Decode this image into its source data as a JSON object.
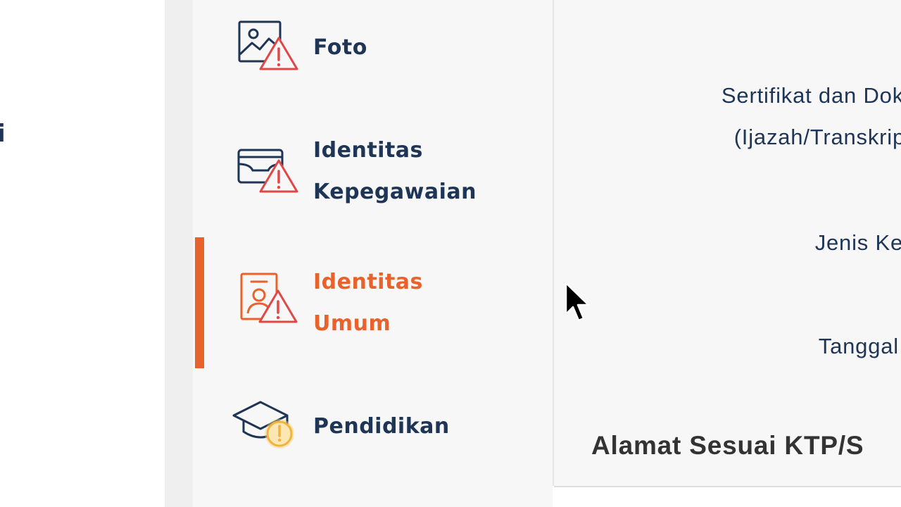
{
  "left_panel": {
    "edge_text": "i"
  },
  "sidebar": {
    "items": [
      {
        "label_lines": [
          "Foto"
        ],
        "icon": "image-warning-icon",
        "status": "warning",
        "active": false
      },
      {
        "label_lines": [
          "Identitas",
          "Kepegawaian"
        ],
        "icon": "wallet-warning-icon",
        "status": "warning",
        "active": false
      },
      {
        "label_lines": [
          "Identitas",
          "Umum"
        ],
        "icon": "id-card-warning-icon",
        "status": "warning",
        "active": true
      },
      {
        "label_lines": [
          "Pendidikan"
        ],
        "icon": "graduation-cap-pending-icon",
        "status": "pending",
        "active": false
      }
    ]
  },
  "main": {
    "fields": [
      {
        "lines": [
          "Sertifikat dan Dok",
          "(Ijazah/Transkrip"
        ]
      },
      {
        "lines": [
          "Jenis Ke"
        ]
      },
      {
        "lines": [
          "Tanggal"
        ]
      }
    ],
    "section_heading": "Alamat Sesuai KTP/S"
  },
  "colors": {
    "navy": "#1e3556",
    "accent": "#e8632b",
    "warning_red": "#e04848",
    "pending_amber": "#f2b33d"
  }
}
